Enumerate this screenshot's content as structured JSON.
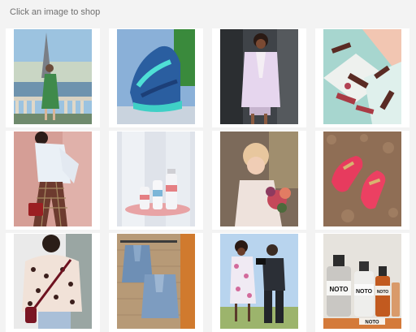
{
  "header": {
    "instruction": "Click an image to shop"
  },
  "tiles": [
    {
      "label": "Paris street style"
    },
    {
      "label": "Teal sneaker"
    },
    {
      "label": "Pink blazer outfit"
    },
    {
      "label": "Lipsticks"
    },
    {
      "label": "White blouse outfit"
    },
    {
      "label": "Skincare products"
    },
    {
      "label": "Bride with bouquet"
    },
    {
      "label": "Pink loafers"
    },
    {
      "label": "Floral top with bag"
    },
    {
      "label": "Denim jackets"
    },
    {
      "label": "Photo shoot"
    },
    {
      "label": "NOTO products"
    }
  ],
  "noto": {
    "brand": "NOTO"
  }
}
